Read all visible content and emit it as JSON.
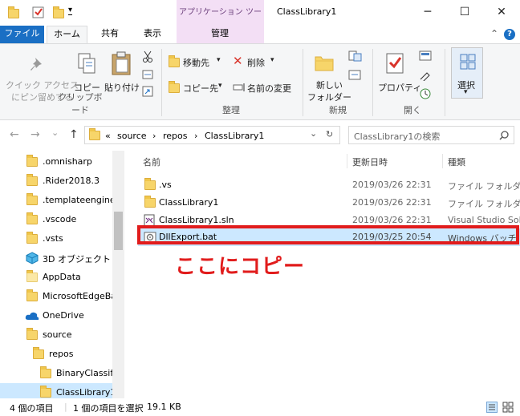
{
  "window": {
    "title": "ClassLibrary1",
    "context_tab": "アプリケーション ツール",
    "minimize_glyph": "─",
    "maximize_glyph": "☐",
    "close_glyph": "✕"
  },
  "qat": {
    "dropdown_glyph": "▾"
  },
  "tabs": {
    "file": "ファイル",
    "home": "ホーム",
    "share": "共有",
    "view": "表示",
    "manage": "管理",
    "collapse_glyph": "⌃",
    "help_glyph": "?"
  },
  "ribbon": {
    "clipboard": {
      "pin": "クイック アクセス\nにピン留めする",
      "copy": "コピー",
      "paste": "貼り付け",
      "group": "クリップボード"
    },
    "organize": {
      "move": "移動先",
      "copy_to": "コピー先",
      "delete": "削除",
      "rename": "名前の変更",
      "group": "整理"
    },
    "new": {
      "new_folder": "新しい\nフォルダー",
      "group": "新規"
    },
    "open": {
      "properties": "プロパティ",
      "group": "開く"
    },
    "select": {
      "select": "選択"
    }
  },
  "address": {
    "overflow": "«",
    "crumbs": [
      "source",
      "repos",
      "ClassLibrary1"
    ],
    "sep": "›",
    "dropdown_glyph": "⌄",
    "refresh_glyph": "↻",
    "search_placeholder": "ClassLibrary1の検索"
  },
  "nav": {
    "back_glyph": "←",
    "forward_glyph": "→",
    "recent_glyph": "⌄",
    "up_glyph": "↑",
    "items": [
      ".omnisharp",
      ".Rider2018.3",
      ".templateengine",
      ".vscode",
      ".vsts",
      "3D オブジェクト",
      "AppData",
      "MicrosoftEdgeBa",
      "OneDrive",
      "source",
      "repos",
      "BinaryClassifi",
      "ClassLibrary1"
    ]
  },
  "filelist": {
    "headers": {
      "name": "名前",
      "date": "更新日時",
      "type": "種類"
    },
    "rows": [
      {
        "name": ".vs",
        "date": "2019/03/26 22:31",
        "type": "ファイル フォルダー"
      },
      {
        "name": "ClassLibrary1",
        "date": "2019/03/26 22:31",
        "type": "ファイル フォルダー"
      },
      {
        "name": "ClassLibrary1.sln",
        "date": "2019/03/26 22:31",
        "type": "Visual Studio Solu"
      },
      {
        "name": "DllExport.bat",
        "date": "2019/03/25 20:54",
        "type": "Windows バッチ"
      }
    ],
    "annotation": "ここにコピー"
  },
  "status": {
    "count": "4 個の項目",
    "selected": "1 個の項目を選択",
    "size": "19.1 KB"
  },
  "colors": {
    "accent": "#1a6fc4",
    "selection": "#cce8ff",
    "annotation": "#e11c1c",
    "context_tab": "#f3dff5"
  }
}
